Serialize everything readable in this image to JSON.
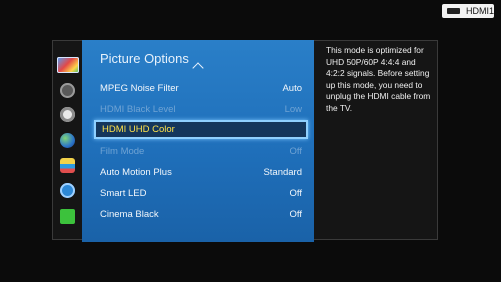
{
  "source_badge": {
    "label": "HDMI1"
  },
  "side_menu": {
    "icons": [
      "picture-icon",
      "sound-icon",
      "broadcasting-icon",
      "network-icon",
      "smart-features-icon",
      "system-icon",
      "support-icon"
    ]
  },
  "panel": {
    "title": "Picture Options",
    "items": [
      {
        "label": "MPEG Noise Filter",
        "value": "Auto"
      },
      {
        "label": "HDMI Black Level",
        "value": "Low"
      },
      {
        "label": "HDMI UHD Color",
        "value": ""
      },
      {
        "label": "Film Mode",
        "value": "Off"
      },
      {
        "label": "Auto Motion Plus",
        "value": "Standard"
      },
      {
        "label": "Smart LED",
        "value": "Off"
      },
      {
        "label": "Cinema Black",
        "value": "Off"
      }
    ]
  },
  "info": {
    "text": "This mode is optimized for UHD 50P/60P 4:4:4 and 4:2:2 signals. Before setting up this mode, you need to unplug the HDMI cable from the TV."
  },
  "colors": {
    "panel_blue": "#1f6fba",
    "selection_border": "#8fd0ff",
    "selected_text": "#ffe24a",
    "disabled_text": "#6fa3d4"
  }
}
